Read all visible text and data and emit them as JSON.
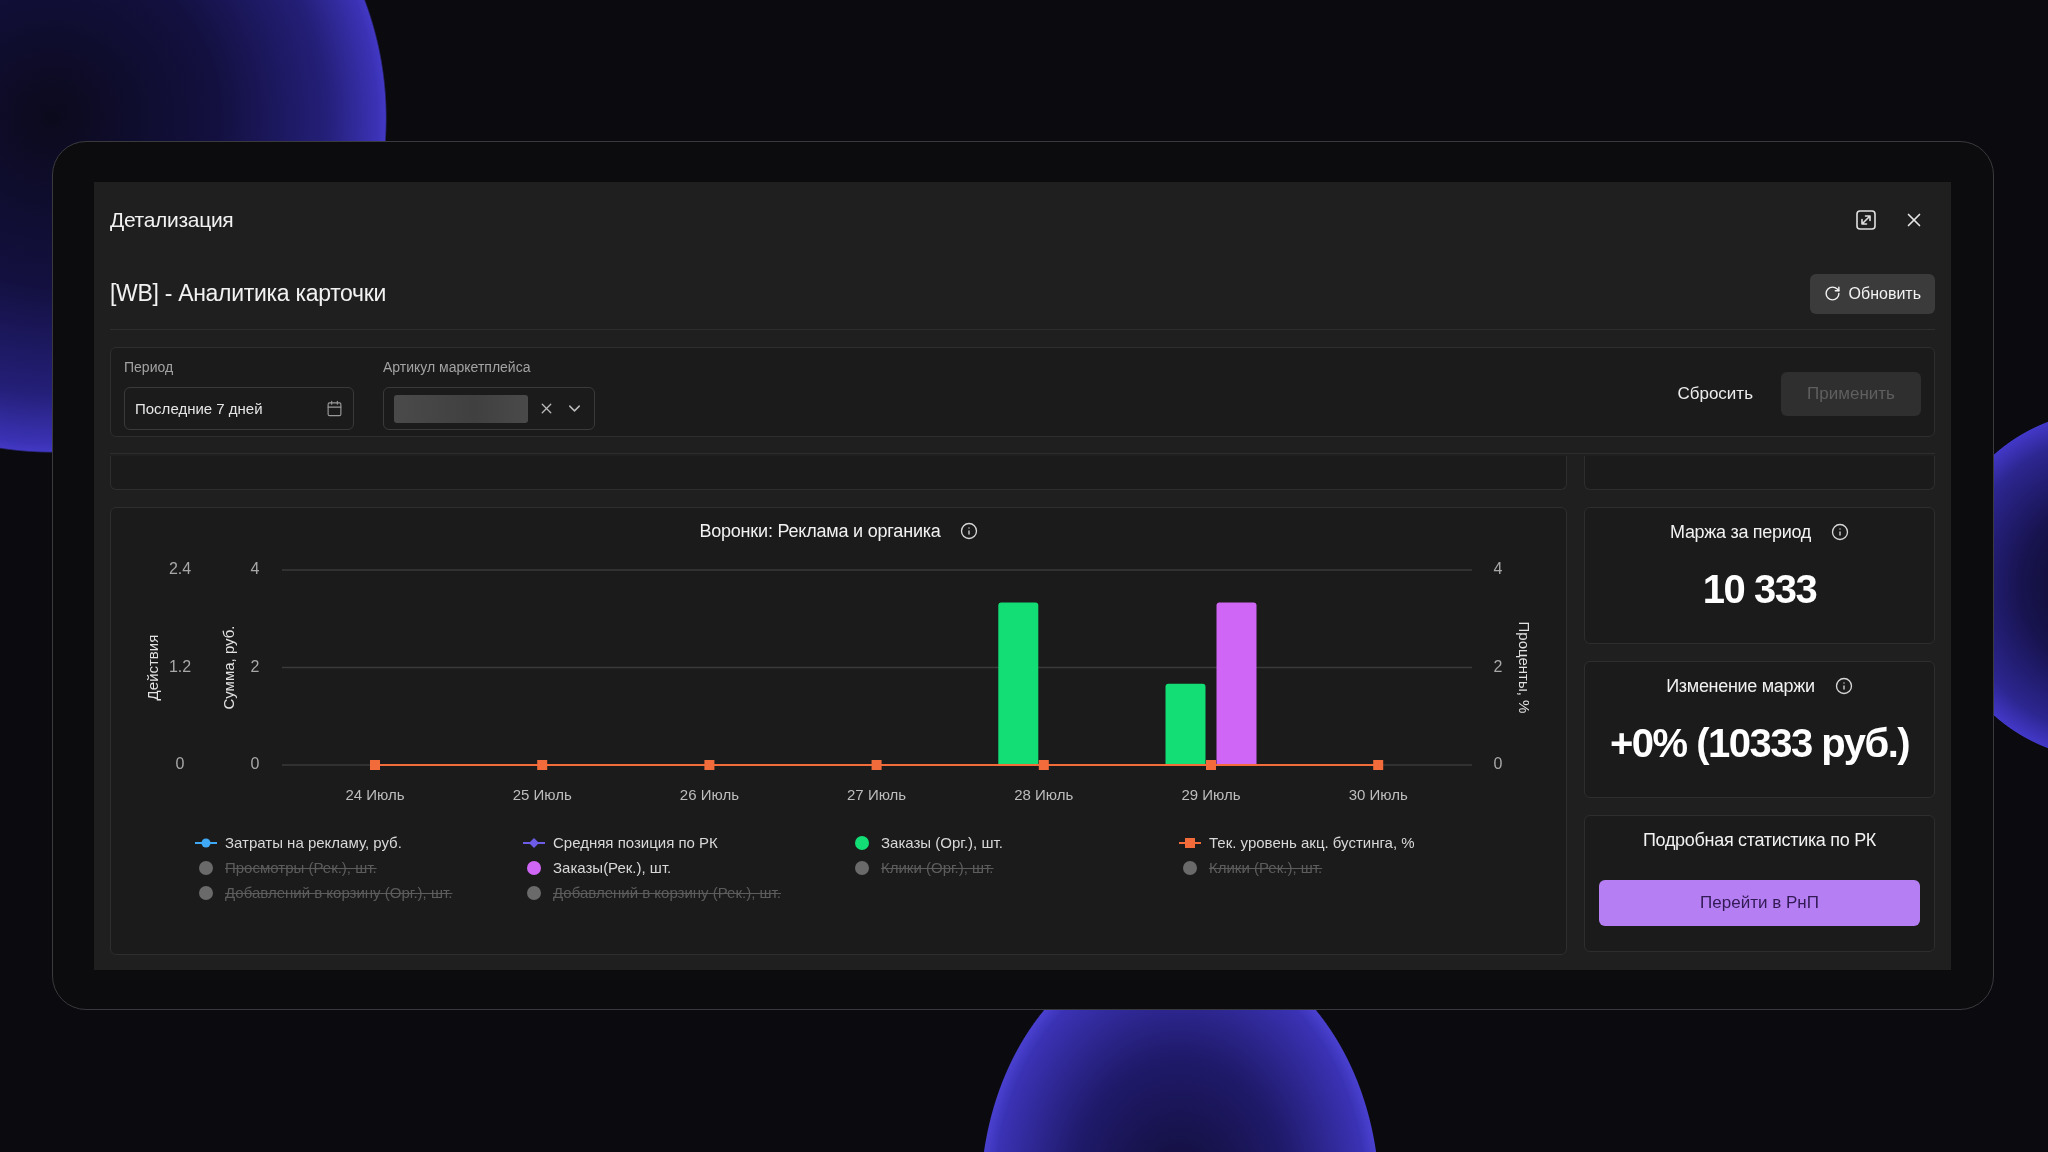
{
  "window": {
    "title": "Детализация"
  },
  "header": {
    "title": "[WB] - Аналитика карточки",
    "refresh_button": "Обновить"
  },
  "filters": {
    "fields": [
      {
        "kind": "date",
        "label": "Период",
        "value": "Последние 7 дней"
      },
      {
        "kind": "select",
        "label": "Артикул маркетплейса",
        "redacted": true
      }
    ],
    "reset_button": "Сбросить",
    "apply_button": {
      "label": "Применить",
      "disabled": true
    }
  },
  "chart_panel": {
    "title": "Воронки: Реклама и органика",
    "info": true,
    "chart_data": {
      "type": "bar",
      "categories": [
        "24 Июль",
        "25 Июль",
        "26 Июль",
        "27 Июль",
        "28 Июль",
        "29 Июль",
        "30 Июль"
      ],
      "ylabel": "Действия",
      "ylim": [
        0,
        2.4
      ],
      "yticks": [
        0,
        1.2,
        2.4
      ],
      "y2label": "Проценты, %",
      "y2lim": [
        0,
        4
      ],
      "y2ticks": [
        0,
        2,
        4
      ],
      "y3label": "Сумма, руб.",
      "y3lim": [
        0,
        4
      ],
      "y3ticks": [
        0,
        2,
        4
      ],
      "series": [
        {
          "name": "Затраты на рекламу, руб.",
          "axis": "y3",
          "color": "#3fa9f5",
          "values": [
            null,
            null,
            null,
            null,
            null,
            null,
            null
          ]
        },
        {
          "name": "Средняя позиция по РК",
          "axis": "y",
          "color": "#6c5ce7",
          "values": [
            null,
            null,
            null,
            null,
            null,
            null,
            null
          ]
        },
        {
          "name": "Заказы (Орг.), шт.",
          "axis": "y",
          "color": "#12de75",
          "values": [
            0,
            0,
            0,
            0,
            2,
            1,
            0
          ]
        },
        {
          "name": "Тек. уровень акц. бустинга, %",
          "axis": "y2",
          "color": "#f26b3a",
          "values": [
            0,
            0,
            0,
            0,
            0,
            0,
            0
          ]
        },
        {
          "name": "Просмотры (Рек.), шт.",
          "values": [
            null,
            null,
            null,
            null,
            null,
            null,
            null
          ]
        },
        {
          "name": "Заказы(Рек.), шт.",
          "axis": "y",
          "color": "#cf66f5",
          "values": [
            0,
            0,
            0,
            0,
            0,
            2,
            0
          ]
        },
        {
          "name": "Клики (Орг.), шт.",
          "values": [
            null,
            null,
            null,
            null,
            null,
            null,
            null
          ]
        },
        {
          "name": "Клики (Рек.), шт.",
          "values": [
            null,
            null,
            null,
            null,
            null,
            null,
            null
          ]
        },
        {
          "name": "Добавлений в корзину (Орг.), шт.",
          "values": [
            null,
            null,
            null,
            null,
            null,
            null,
            null
          ]
        },
        {
          "name": "Добавлений в корзину (Рек.), шт.",
          "values": [
            null,
            null,
            null,
            null,
            null,
            null,
            null
          ]
        }
      ]
    },
    "legend": [
      {
        "kind": "line-dot",
        "hidden": false
      },
      {
        "kind": "line-diamond",
        "hidden": false
      },
      {
        "kind": "dot",
        "hidden": false
      },
      {
        "kind": "line-square",
        "hidden": false
      },
      {
        "kind": "dot",
        "hidden": true
      },
      {
        "kind": "dot",
        "hidden": false
      },
      {
        "kind": "dot",
        "hidden": true
      },
      {
        "kind": "dot",
        "hidden": true
      },
      {
        "kind": "dot",
        "hidden": true
      },
      {
        "kind": "dot",
        "hidden": true
      }
    ]
  },
  "stats": [
    {
      "kind": "metric",
      "title": "Маржа за период",
      "info": true,
      "value": "10 333"
    },
    {
      "kind": "metric",
      "title": "Изменение маржи",
      "info": true,
      "value": "+0% (10333 руб.)"
    },
    {
      "kind": "link",
      "title": "Подробная статистика по РК",
      "info": false,
      "button": "Перейти в РнП"
    }
  ]
}
